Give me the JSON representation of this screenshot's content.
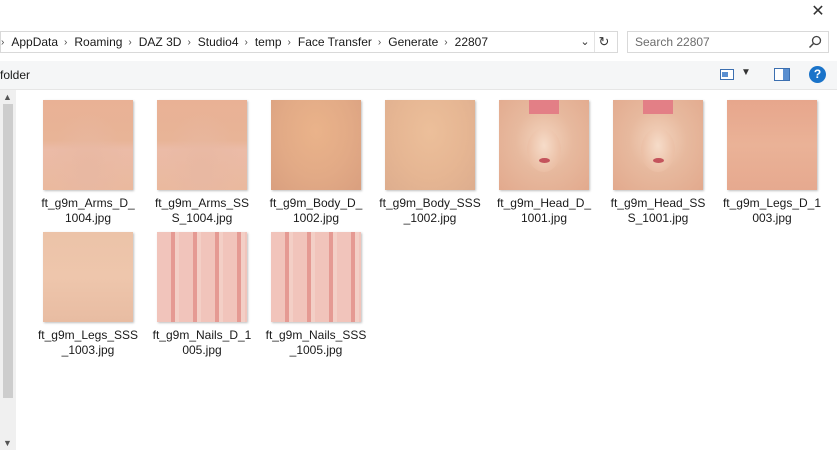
{
  "breadcrumb": [
    "AppData",
    "Roaming",
    "DAZ 3D",
    "Studio4",
    "temp",
    "Face Transfer",
    "Generate",
    "22807"
  ],
  "search": {
    "placeholder": "Search 22807"
  },
  "commandbar": {
    "label": "folder"
  },
  "window": {
    "close_glyph": "✕"
  },
  "files": [
    {
      "name": "ft_g9m_Arms_D_1004.jpg",
      "thumb": "arms"
    },
    {
      "name": "ft_g9m_Arms_SSS_1004.jpg",
      "thumb": "arms"
    },
    {
      "name": "ft_g9m_Body_D_1002.jpg",
      "thumb": "body"
    },
    {
      "name": "ft_g9m_Body_SSS_1002.jpg",
      "thumb": "body2"
    },
    {
      "name": "ft_g9m_Head_D_1001.jpg",
      "thumb": "head"
    },
    {
      "name": "ft_g9m_Head_SSS_1001.jpg",
      "thumb": "head"
    },
    {
      "name": "ft_g9m_Legs_D_1003.jpg",
      "thumb": "legs"
    },
    {
      "name": "ft_g9m_Legs_SSS_1003.jpg",
      "thumb": "legs2"
    },
    {
      "name": "ft_g9m_Nails_D_1005.jpg",
      "thumb": "nails"
    },
    {
      "name": "ft_g9m_Nails_SSS_1005.jpg",
      "thumb": "nails"
    }
  ],
  "icons": {
    "close": "close-icon",
    "search": "search-icon",
    "refresh": "refresh-icon",
    "dropdown": "chevron-down-icon",
    "view": "view-options-icon",
    "preview_pane": "preview-pane-icon",
    "help": "help-icon"
  },
  "colors": {
    "help_blue": "#1a73c9"
  }
}
